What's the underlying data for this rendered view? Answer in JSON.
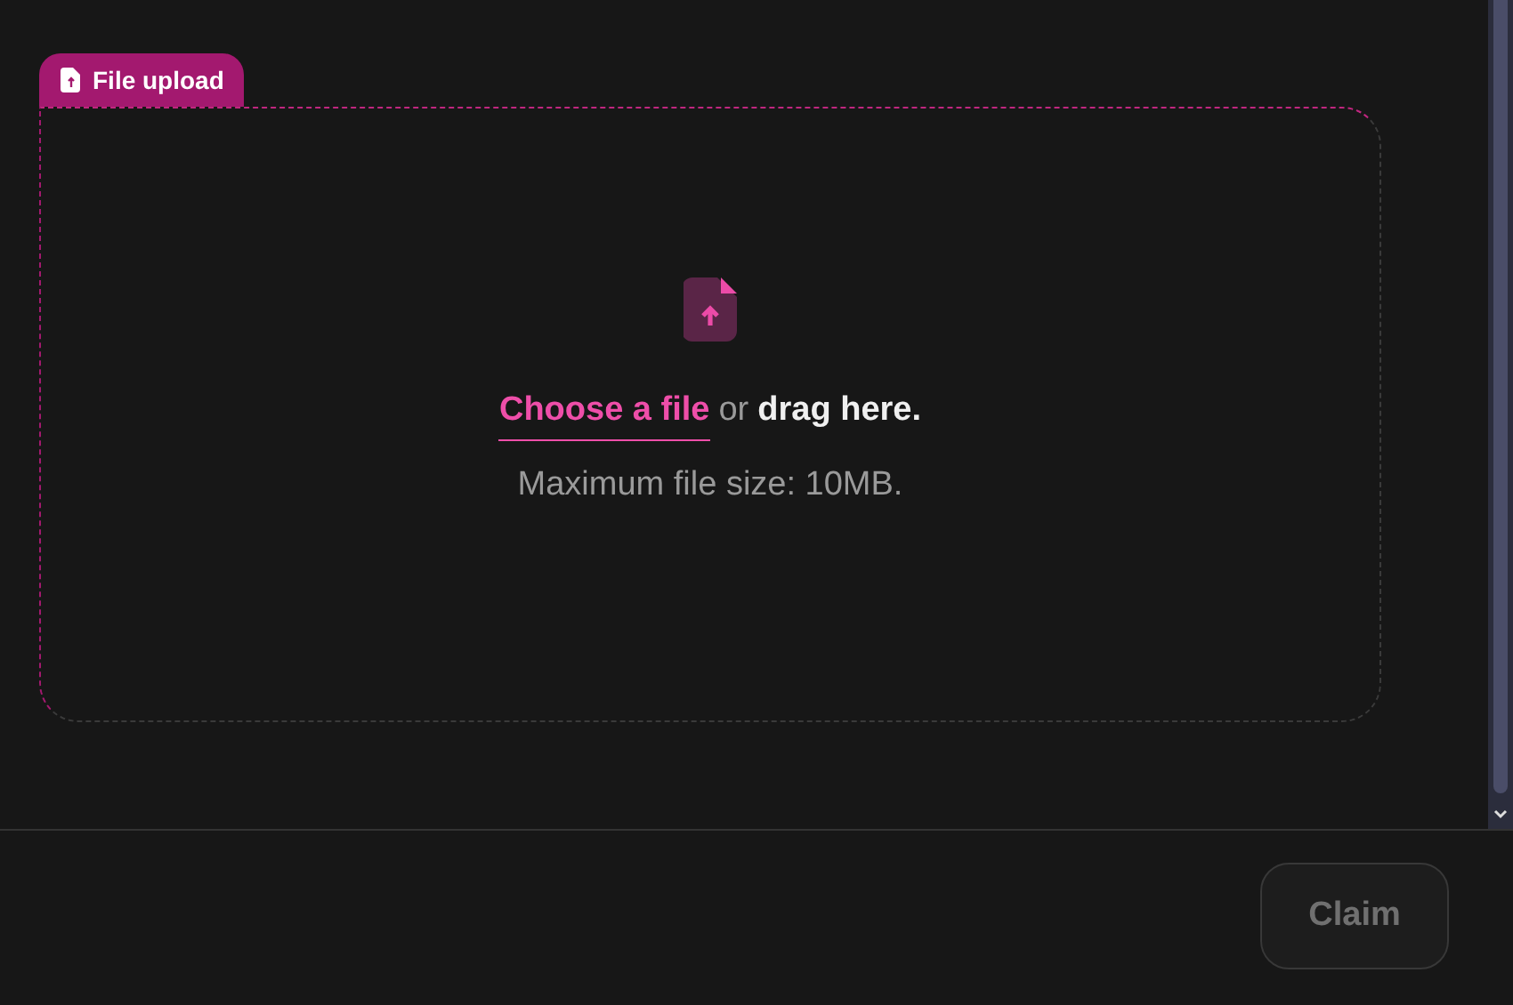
{
  "upload": {
    "tab_label": "File upload",
    "choose_link": "Choose a file",
    "connector": "or",
    "drag_text": "drag here.",
    "hint": "Maximum file size: 10MB."
  },
  "footer": {
    "button": {
      "label": "Claim",
      "disabled": true
    }
  }
}
